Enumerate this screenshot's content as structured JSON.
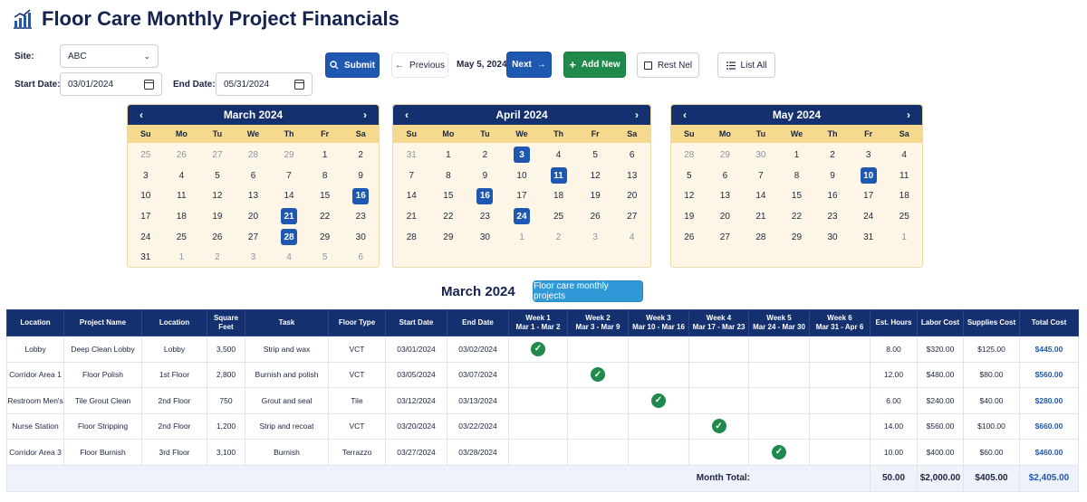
{
  "header": {
    "title": "Floor Care Monthly Project Financials"
  },
  "form": {
    "site_label": "Site:",
    "site_value": "ABC",
    "start_label": "Start Date:",
    "start_value": "03/01/2024",
    "end_label": "End Date:",
    "end_value": "05/31/2024"
  },
  "toolbar": {
    "submit": "Submit",
    "previous": "Previous",
    "current_date": "May 5, 2024",
    "next": "Next",
    "add_new": "Add New",
    "rest_nel": "Rest Nel",
    "list_all": "List All"
  },
  "calendars": {
    "dow": [
      "Su",
      "Mo",
      "Tu",
      "We",
      "Th",
      "Fr",
      "Sa"
    ],
    "months": [
      {
        "title": "March 2024",
        "days": [
          {
            "d": "25",
            "m": true
          },
          {
            "d": "26",
            "m": true
          },
          {
            "d": "27",
            "m": true
          },
          {
            "d": "28",
            "m": true
          },
          {
            "d": "29",
            "m": true
          },
          {
            "d": "1"
          },
          {
            "d": "2"
          },
          {
            "d": "3"
          },
          {
            "d": "4"
          },
          {
            "d": "5"
          },
          {
            "d": "6"
          },
          {
            "d": "7"
          },
          {
            "d": "8"
          },
          {
            "d": "9"
          },
          {
            "d": "10"
          },
          {
            "d": "11"
          },
          {
            "d": "12"
          },
          {
            "d": "13"
          },
          {
            "d": "14"
          },
          {
            "d": "15"
          },
          {
            "d": "16",
            "s": true
          },
          {
            "d": "17"
          },
          {
            "d": "18"
          },
          {
            "d": "19"
          },
          {
            "d": "20"
          },
          {
            "d": "21",
            "s": true
          },
          {
            "d": "22"
          },
          {
            "d": "23"
          },
          {
            "d": "24"
          },
          {
            "d": "25"
          },
          {
            "d": "26"
          },
          {
            "d": "27"
          },
          {
            "d": "28",
            "s": true
          },
          {
            "d": "29"
          },
          {
            "d": "30"
          },
          {
            "d": "31"
          },
          {
            "d": "1",
            "m": true
          },
          {
            "d": "2",
            "m": true
          },
          {
            "d": "3",
            "m": true
          },
          {
            "d": "4",
            "m": true
          },
          {
            "d": "5",
            "m": true
          },
          {
            "d": "6",
            "m": true
          }
        ]
      },
      {
        "title": "April 2024",
        "days": [
          {
            "d": "31",
            "m": true
          },
          {
            "d": "1"
          },
          {
            "d": "2"
          },
          {
            "d": "3",
            "s": true
          },
          {
            "d": "4"
          },
          {
            "d": "5"
          },
          {
            "d": "6"
          },
          {
            "d": "7"
          },
          {
            "d": "8"
          },
          {
            "d": "9"
          },
          {
            "d": "10"
          },
          {
            "d": "11",
            "s": true
          },
          {
            "d": "12"
          },
          {
            "d": "13"
          },
          {
            "d": "14"
          },
          {
            "d": "15"
          },
          {
            "d": "16",
            "s": true
          },
          {
            "d": "17"
          },
          {
            "d": "18"
          },
          {
            "d": "19"
          },
          {
            "d": "20"
          },
          {
            "d": "21"
          },
          {
            "d": "22"
          },
          {
            "d": "23"
          },
          {
            "d": "24",
            "s": true
          },
          {
            "d": "25"
          },
          {
            "d": "26"
          },
          {
            "d": "27"
          },
          {
            "d": "28"
          },
          {
            "d": "29"
          },
          {
            "d": "30"
          },
          {
            "d": "1",
            "m": true
          },
          {
            "d": "2",
            "m": true
          },
          {
            "d": "3",
            "m": true
          },
          {
            "d": "4",
            "m": true
          }
        ]
      },
      {
        "title": "May 2024",
        "days": [
          {
            "d": "28",
            "m": true
          },
          {
            "d": "29",
            "m": true
          },
          {
            "d": "30",
            "m": true
          },
          {
            "d": "1"
          },
          {
            "d": "2"
          },
          {
            "d": "3"
          },
          {
            "d": "4"
          },
          {
            "d": "5"
          },
          {
            "d": "6"
          },
          {
            "d": "7"
          },
          {
            "d": "8"
          },
          {
            "d": "9"
          },
          {
            "d": "10",
            "s": true
          },
          {
            "d": "11"
          },
          {
            "d": "12"
          },
          {
            "d": "13"
          },
          {
            "d": "14"
          },
          {
            "d": "15"
          },
          {
            "d": "16"
          },
          {
            "d": "17"
          },
          {
            "d": "18"
          },
          {
            "d": "19"
          },
          {
            "d": "20"
          },
          {
            "d": "21"
          },
          {
            "d": "22"
          },
          {
            "d": "23"
          },
          {
            "d": "24"
          },
          {
            "d": "25"
          },
          {
            "d": "26"
          },
          {
            "d": "27"
          },
          {
            "d": "28"
          },
          {
            "d": "29"
          },
          {
            "d": "30"
          },
          {
            "d": "31"
          },
          {
            "d": "1",
            "m": true
          }
        ]
      }
    ]
  },
  "section": {
    "month_title": "March 2024",
    "filter_button": "Floor care monthly projects"
  },
  "table": {
    "columns": [
      [
        "Location"
      ],
      [
        "Project Name"
      ],
      [
        "Location"
      ],
      [
        "Square",
        "Feet"
      ],
      [
        "Task"
      ],
      [
        "Floor Type"
      ],
      [
        "Start Date"
      ],
      [
        "End Date"
      ],
      [
        "Week 1",
        "Mar 1 - Mar 2"
      ],
      [
        "Week 2",
        "Mar 3 - Mar 9"
      ],
      [
        "Week 3",
        "Mar 10 - Mar 16"
      ],
      [
        "Week 4",
        "Mar 17 - Mar 23"
      ],
      [
        "Week 5",
        "Mar 24 - Mar 30"
      ],
      [
        "Week 6",
        "Mar 31 - Apr 6"
      ],
      [
        "Est. Hours"
      ],
      [
        "Labor Cost"
      ],
      [
        "Supplies Cost"
      ],
      [
        "Total Cost"
      ]
    ],
    "rows": [
      {
        "loc": "Lobby",
        "project": "Deep Clean Lobby",
        "floor_loc": "Lobby",
        "sqft": "3,500",
        "task": "Strip and wax",
        "type": "VCT",
        "start": "03/01/2024",
        "end": "03/02/2024",
        "week": 1,
        "hours": "8.00",
        "labor": "$320.00",
        "supplies": "$125.00",
        "total": "$445.00"
      },
      {
        "loc": "Corridor Area 1",
        "project": "Floor Polish",
        "floor_loc": "1st Floor",
        "sqft": "2,800",
        "task": "Burnish and polish",
        "type": "VCT",
        "start": "03/05/2024",
        "end": "03/07/2024",
        "week": 2,
        "hours": "12.00",
        "labor": "$480.00",
        "supplies": "$80.00",
        "total": "$560.00"
      },
      {
        "loc": "Restroom Men's",
        "project": "Tile Grout Clean",
        "floor_loc": "2nd Floor",
        "sqft": "750",
        "task": "Grout and seal",
        "type": "Tile",
        "start": "03/12/2024",
        "end": "03/13/2024",
        "week": 3,
        "hours": "6.00",
        "labor": "$240.00",
        "supplies": "$40.00",
        "total": "$280.00"
      },
      {
        "loc": "Nurse Station",
        "project": "Floor Stripping",
        "floor_loc": "2nd Floor",
        "sqft": "1,200",
        "task": "Strip and recoat",
        "type": "VCT",
        "start": "03/20/2024",
        "end": "03/22/2024",
        "week": 4,
        "hours": "14.00",
        "labor": "$560.00",
        "supplies": "$100.00",
        "total": "$660.00"
      },
      {
        "loc": "Corridor Area 3",
        "project": "Floor Burnish",
        "floor_loc": "3rd Floor",
        "sqft": "3,100",
        "task": "Burnish",
        "type": "Terrazzo",
        "start": "03/27/2024",
        "end": "03/28/2024",
        "week": 5,
        "hours": "10.00",
        "labor": "$400.00",
        "supplies": "$60.00",
        "total": "$460.00"
      }
    ],
    "footer": {
      "label": "Month Total:",
      "hours": "50.00",
      "labor": "$2,000.00",
      "supplies": "$405.00",
      "total": "$2,405.00"
    }
  }
}
